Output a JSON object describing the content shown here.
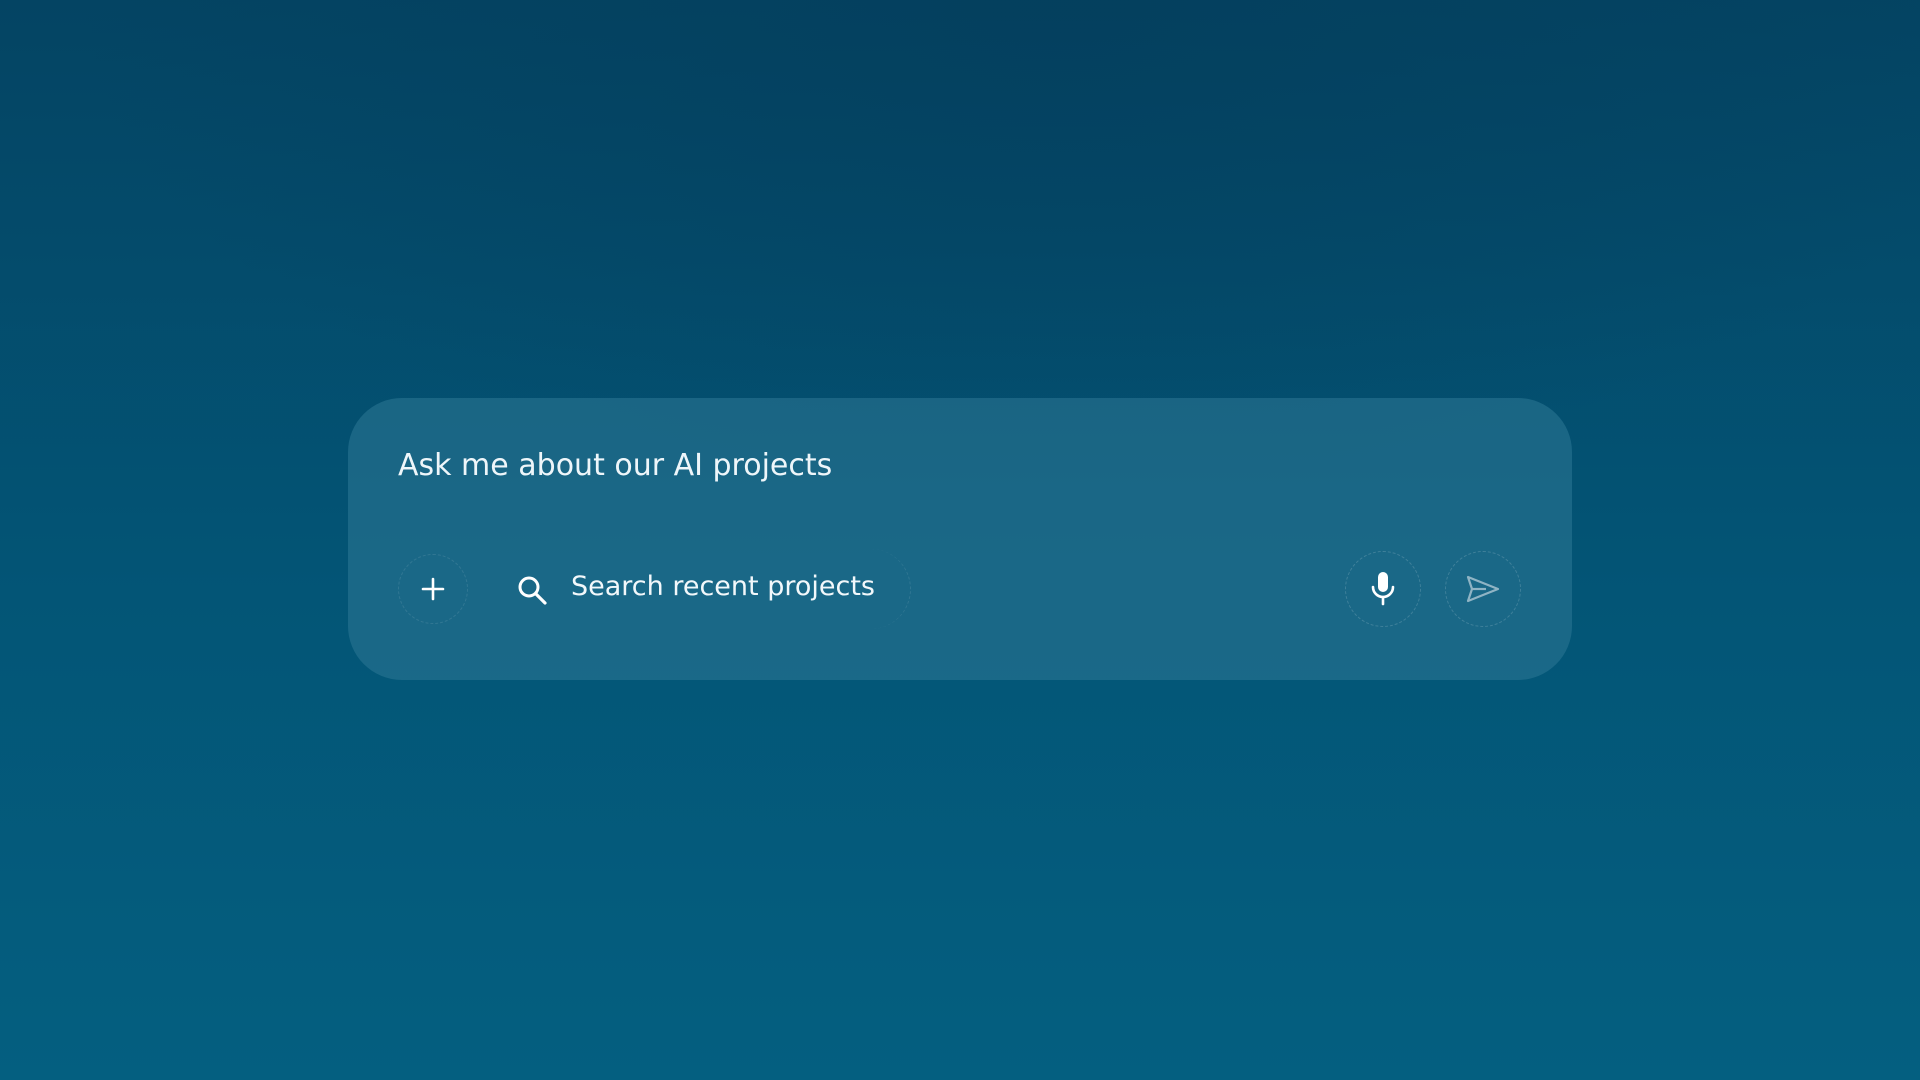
{
  "composer": {
    "placeholder": "Ask me about our AI projects",
    "value": "",
    "add_icon": "plus-icon",
    "search_chip": {
      "icon": "search-icon",
      "label": "Search recent projects"
    },
    "mic_icon": "microphone-icon",
    "send_icon": "send-icon"
  },
  "colors": {
    "background_top": "#044463",
    "background_bottom": "#045f80",
    "panel": "#2d7896",
    "text": "#eef6fa",
    "send_disabled": "#8fb4c4"
  }
}
